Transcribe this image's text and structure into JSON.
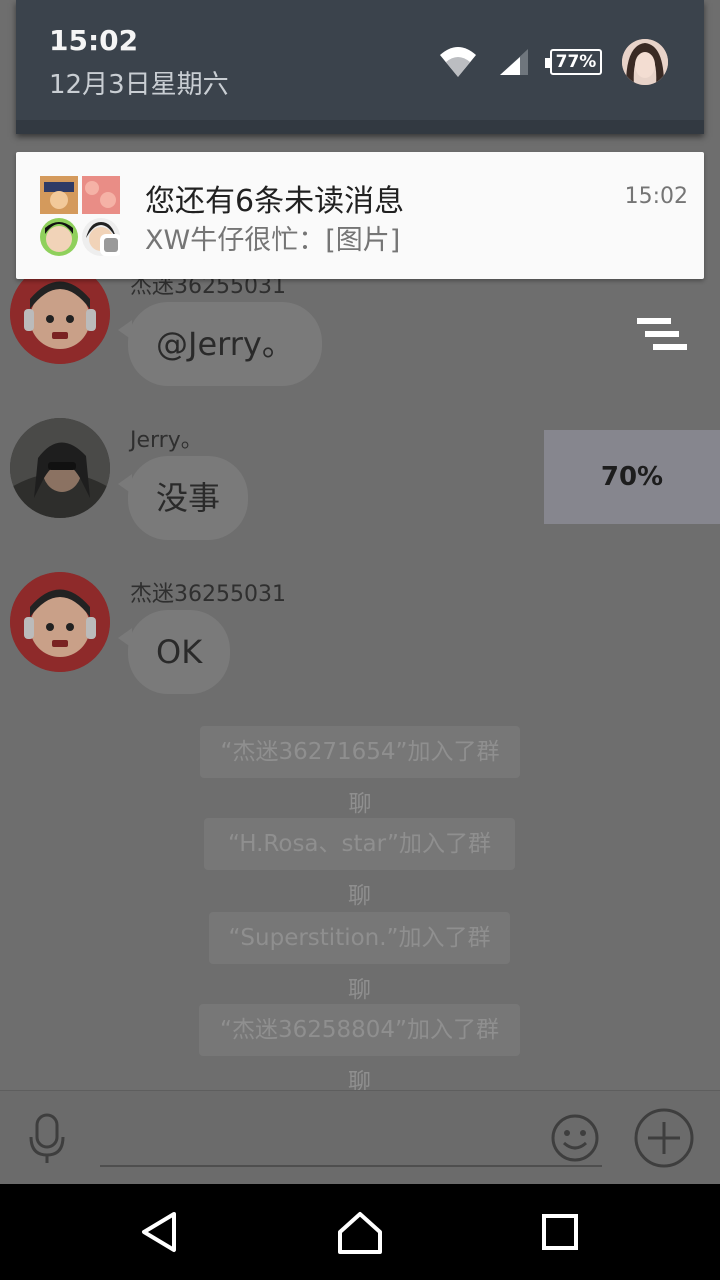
{
  "status": {
    "time": "15:02",
    "date": "12月3日星期六",
    "battery": "77%"
  },
  "notification": {
    "title": "您还有6条未读消息",
    "subtitle": "XW牛仔很忙：[图片]",
    "time": "15:02"
  },
  "messages": [
    {
      "sender": "杰迷36255031",
      "text": "@Jerry。"
    },
    {
      "sender": "Jerry。",
      "text": "没事"
    },
    {
      "sender": "杰迷36255031",
      "text": "OK"
    }
  ],
  "system_messages": [
    "“杰迷36271654”加入了群聊",
    "“H.Rosa、star”加入了群聊",
    "“Superstition.”加入了群聊",
    "“杰迷36258804”加入了群聊"
  ],
  "overlay": {
    "percent": "70%"
  }
}
